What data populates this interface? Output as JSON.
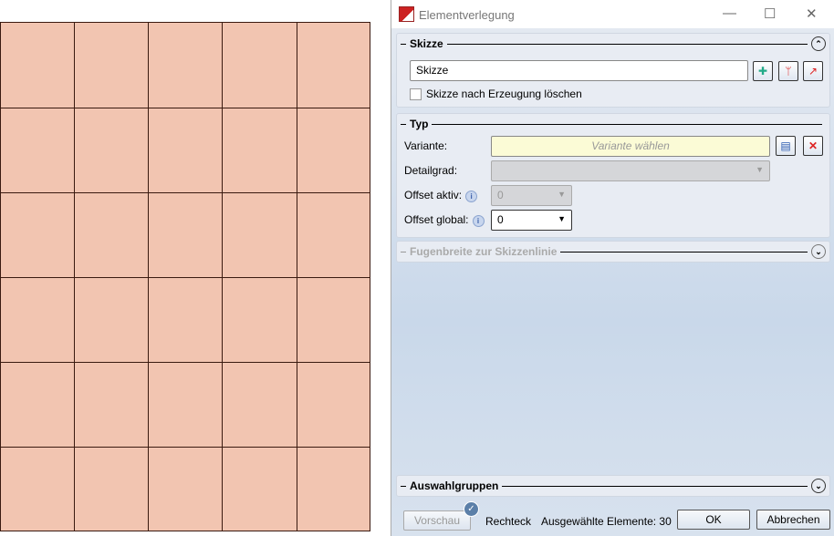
{
  "canvas": {
    "columns": 5,
    "rows": 6,
    "fill_color": "#f2c5b1"
  },
  "dialog": {
    "title": "Elementverlegung",
    "window_buttons": {
      "minimize": "—",
      "maximize": "☐",
      "close": "✕"
    },
    "skizze": {
      "header": "Skizze",
      "value": "Skizze",
      "checkbox_label": "Skizze nach Erzeugung löschen",
      "checked": false
    },
    "typ": {
      "header": "Typ",
      "variante_label": "Variante:",
      "variante_placeholder": "Variante wählen",
      "detailgrad_label": "Detailgrad:",
      "offset_aktiv_label": "Offset aktiv:",
      "offset_aktiv_value": "0",
      "offset_global_label": "Offset global:",
      "offset_global_value": "0"
    },
    "fugenbreite": {
      "header": "Fugenbreite zur Skizzenlinie"
    },
    "auswahlgruppen": {
      "header": "Auswahlgruppen"
    },
    "footer": {
      "vorschau": "Vorschau",
      "shape": "Rechteck",
      "selected": "Ausgewählte Elemente: 30",
      "ok": "OK",
      "cancel": "Abbrechen"
    }
  }
}
